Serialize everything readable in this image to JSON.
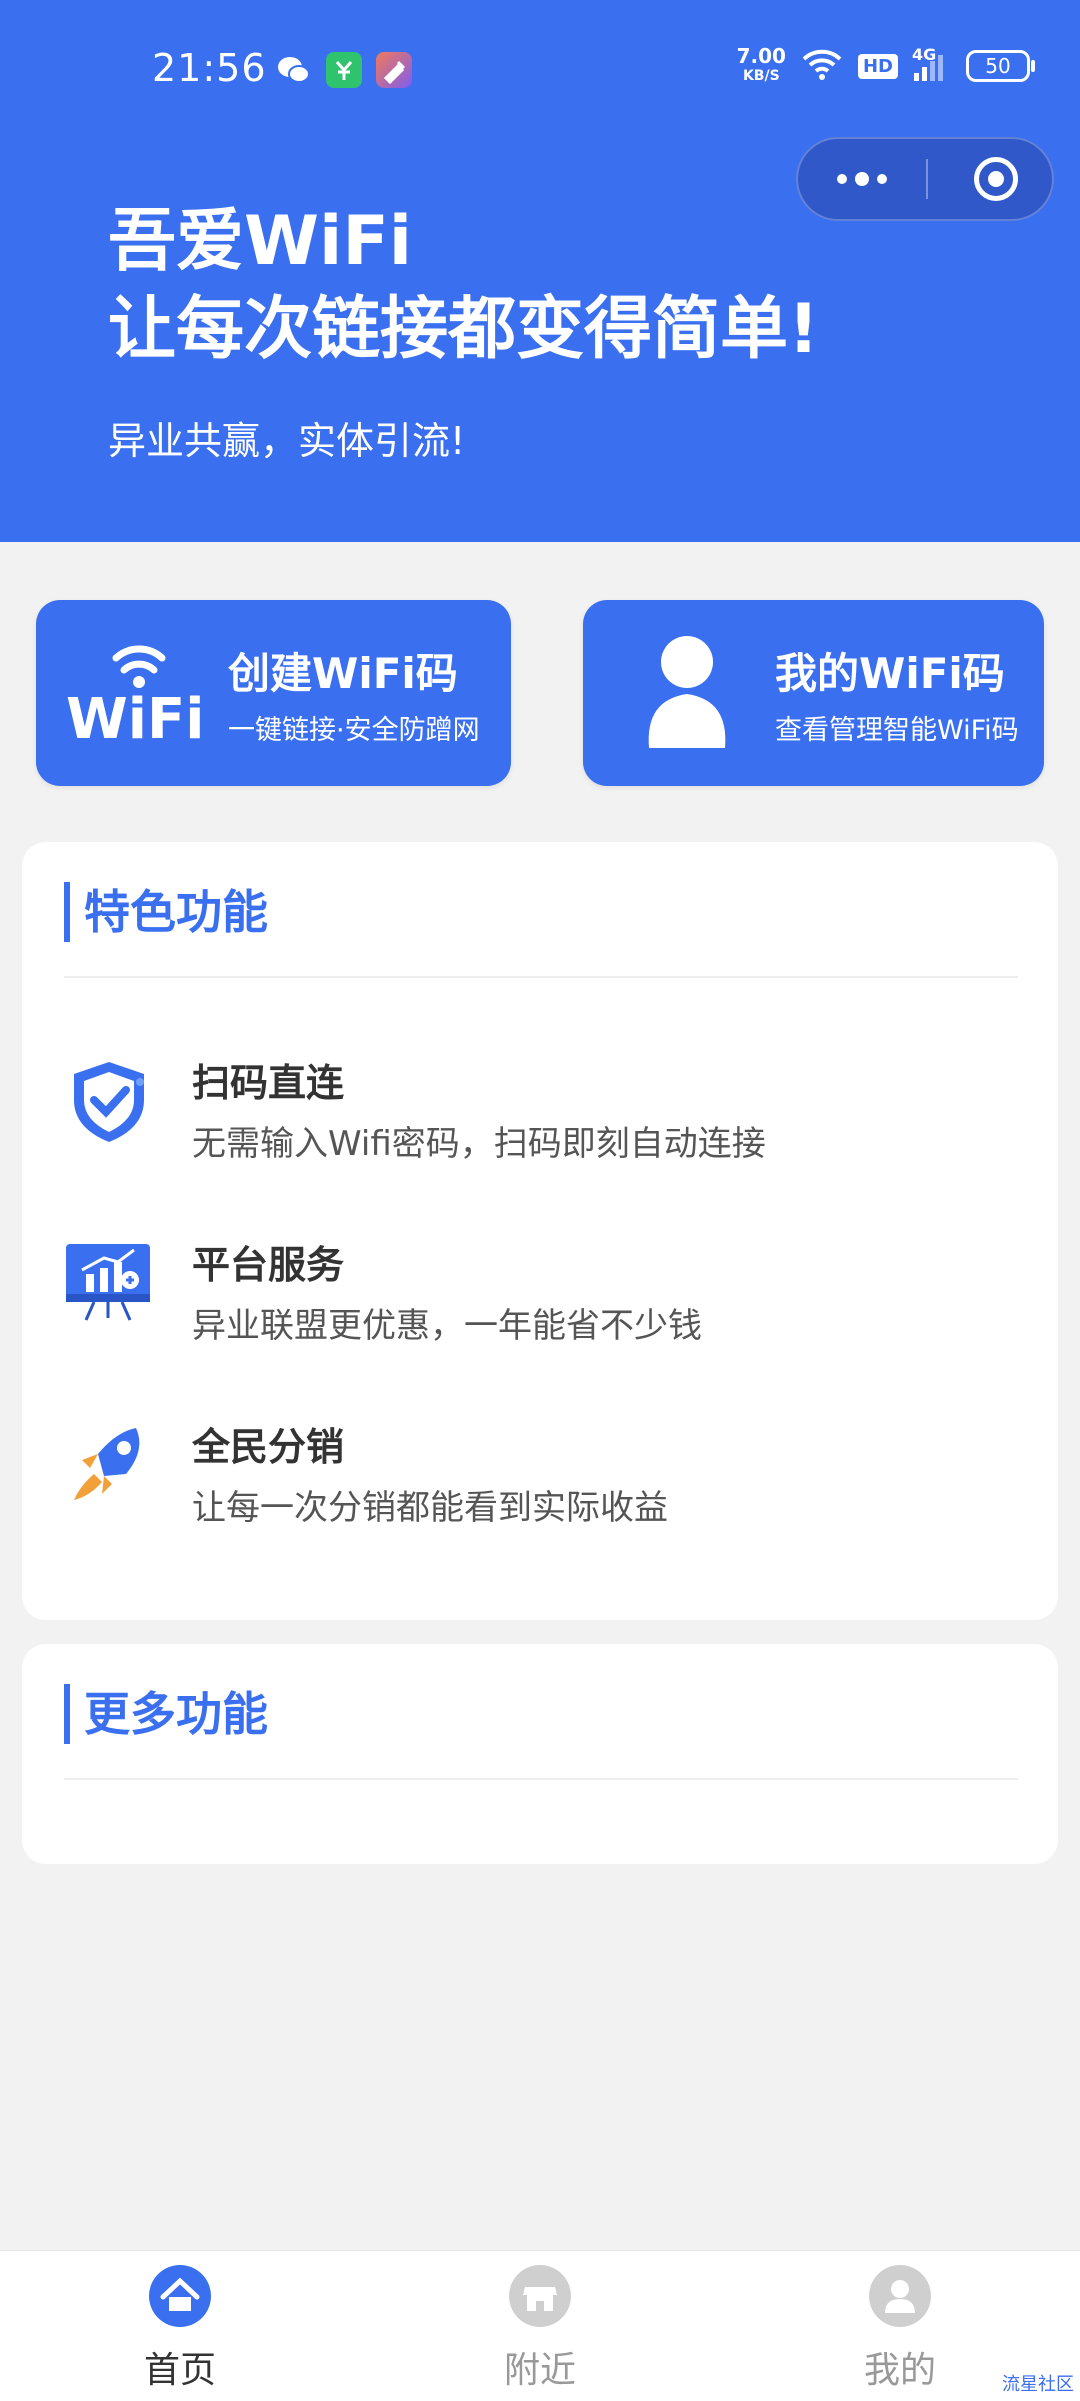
{
  "status_bar": {
    "time": "21:56",
    "speed_value": "7.00",
    "speed_unit": "KB/S",
    "hd": "HD",
    "network": "4G",
    "battery": "50"
  },
  "header": {
    "title_line1": "吾爱WiFi",
    "title_line2": "让每次链接都变得简单!",
    "subtitle": "异业共赢，实体引流!",
    "background_color": "#3a6ff0"
  },
  "capsule": {
    "more_icon": "more-dots-icon",
    "close_icon": "target-circle-icon"
  },
  "actions": [
    {
      "title": "创建WiFi码",
      "desc": "一键链接·安全防蹭网",
      "icon": "wifi-logo-icon"
    },
    {
      "title": "我的WiFi码",
      "desc": "查看管理智能WiFi码",
      "icon": "person-icon"
    }
  ],
  "features_panel": {
    "title": "特色功能",
    "items": [
      {
        "name": "扫码直连",
        "text": "无需输入Wifi密码，扫码即刻自动连接",
        "icon": "shield-check-icon"
      },
      {
        "name": "平台服务",
        "text": "异业联盟更优惠，一年能省不少钱",
        "icon": "chart-board-icon"
      },
      {
        "name": "全民分销",
        "text": "让每一次分销都能看到实际收益",
        "icon": "rocket-icon"
      }
    ]
  },
  "more_panel": {
    "title": "更多功能"
  },
  "tabbar": {
    "tabs": [
      {
        "label": "首页",
        "icon": "home-icon",
        "active": true
      },
      {
        "label": "附近",
        "icon": "store-icon",
        "active": false
      },
      {
        "label": "我的",
        "icon": "user-icon",
        "active": false
      }
    ]
  },
  "watermark": "流星社区"
}
